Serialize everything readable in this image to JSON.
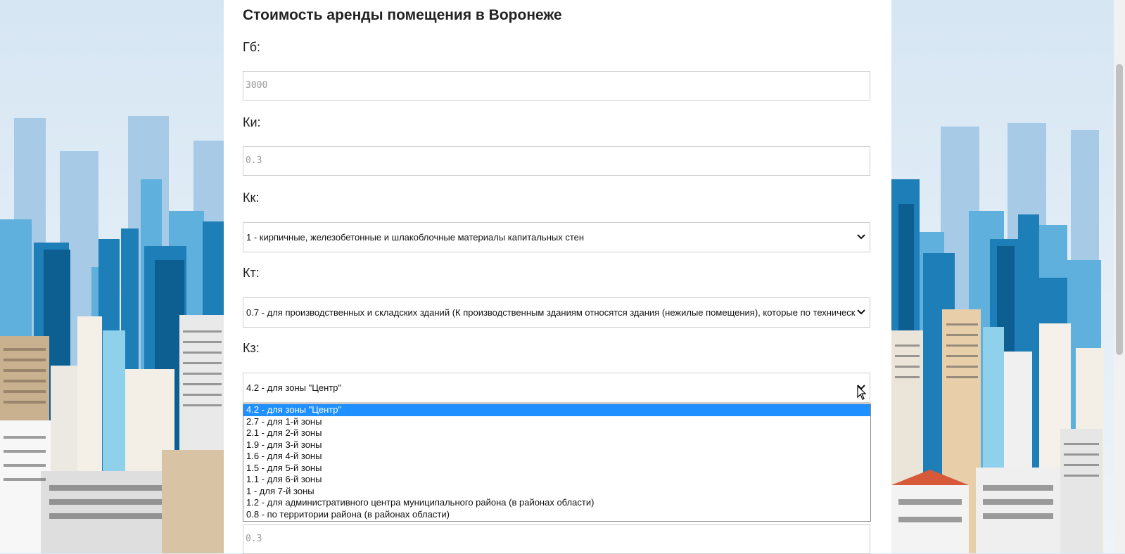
{
  "page": {
    "title": "Стоимость аренды помещения в Воронеже"
  },
  "form": {
    "gb": {
      "label": "Гб:",
      "value": "3000"
    },
    "ki": {
      "label": "Ки:",
      "value": "0.3"
    },
    "kk": {
      "label": "Кк:",
      "selected": "1 - кирпичные, железобетонные и шлакоблочные материалы капитальных стен"
    },
    "kt": {
      "label": "Кт:",
      "selected": "0.7 - для производственных и складских зданий (К производственным зданиям относятся здания (нежилые помещения), которые по техническ"
    },
    "kz": {
      "label": "Кз:",
      "selected": "4.2 - для зоны \"Центр\"",
      "options": [
        "4.2 - для зоны \"Центр\"",
        "2.7 - для 1-й зоны",
        "2.1 - для 2-й зоны",
        "1.9 - для 3-й зоны",
        "1.6 - для 4-й зоны",
        "1.5 - для 5-й зоны",
        "1.1 - для 6-й зоны",
        "1 - для 7-й зоны",
        "1.2 - для административного центра муниципального района (в районах области)",
        "0.8 - по территории района (в районах области)"
      ]
    },
    "next_field_value": "0.3"
  },
  "colors": {
    "highlight": "#1e90ff",
    "sky": "#dbe9f4"
  }
}
